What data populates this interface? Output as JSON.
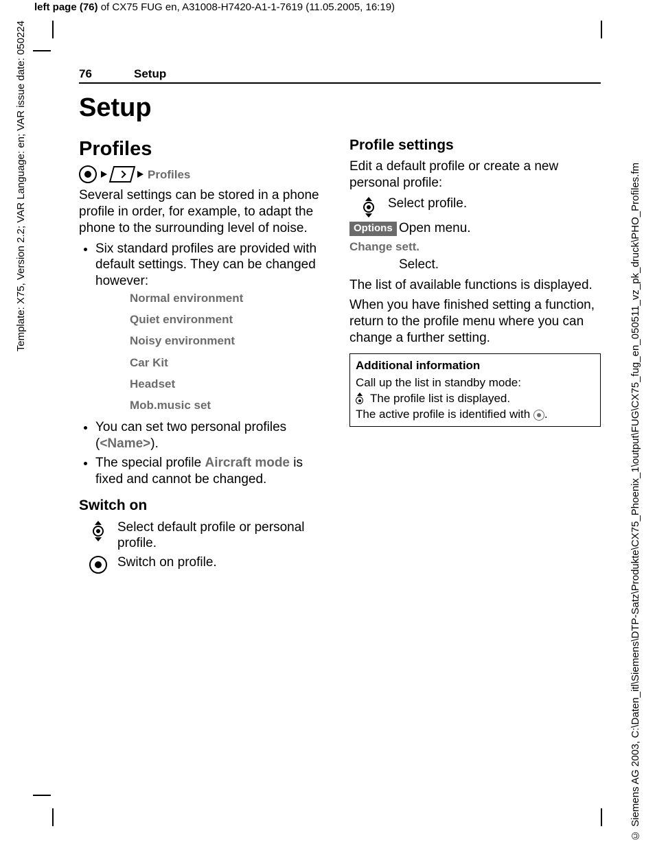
{
  "top": {
    "left_bold": "left page (76)",
    "rest": " of CX75 FUG en, A31008-H7420-A1-1-7619 (11.05.2005, 16:19)"
  },
  "side_left": "Template: X75, Version 2.2; VAR Language: en; VAR issue date: 050224",
  "side_right": "© Siemens AG 2003, C:\\Daten_itl\\Siemens\\DTP-Satz\\Produkte\\CX75_Phoenix_1\\output\\FUG\\CX75_fug_en_050511_vz_pk_druck\\PHO_Profiles.fm",
  "head": {
    "page": "76",
    "section": "Setup"
  },
  "title": "Setup",
  "left": {
    "h2": "Profiles",
    "crumb": "Profiles",
    "intro": "Several settings can be stored in a phone profile in order, for example, to adapt the phone to the surrounding level of noise.",
    "b1": "Six standard profiles are provided with default settings. They can be changed however:",
    "env": [
      "Normal environment",
      "Quiet environment",
      "Noisy environment",
      "Car Kit",
      "Headset",
      "Mob.music set"
    ],
    "b2_pre": "You can set two personal profiles (",
    "b2_key": "<Name>",
    "b2_post": ").",
    "b3_pre": "The special profile ",
    "b3_key": "Aircraft mode",
    "b3_post": " is fixed and cannot be changed.",
    "switch_h": "Switch on",
    "switch1": "Select default profile or personal profile.",
    "switch2": "Switch on profile."
  },
  "right": {
    "h3": "Profile settings",
    "intro": "Edit a default profile or create a new personal profile:",
    "step1": "Select profile.",
    "options": "Options",
    "step2": "Open menu.",
    "change": "Change sett.",
    "step3": "Select.",
    "p1": "The list of available functions is displayed.",
    "p2": "When you have finished setting a function, return to the profile menu where you can change a further setting.",
    "box": {
      "hd": "Additional information",
      "l1": "Call up the list in standby mode:",
      "l2": "The profile list is displayed.",
      "l3_pre": "The active profile is identified with ",
      "l3_post": "."
    }
  }
}
